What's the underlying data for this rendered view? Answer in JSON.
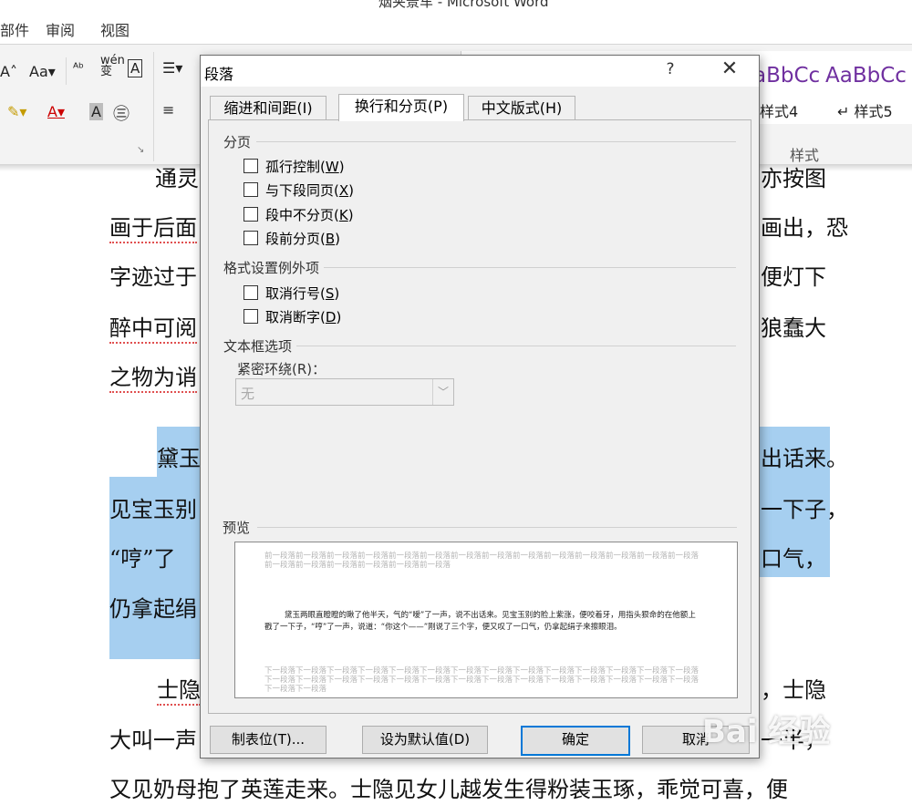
{
  "window": {
    "title": "烟夹景车 - Microsoft Word"
  },
  "menu": [
    "部件",
    "审阅",
    "视图"
  ],
  "ribbon": {
    "font_aa": "Aa",
    "wen": "wén",
    "style_samples": [
      {
        "sample": "aBbCc",
        "name": "样式4"
      },
      {
        "sample": "AaBbCc",
        "name": "样式5"
      }
    ],
    "styles_group": "样式"
  },
  "document": {
    "left_lines": [
      "通灵",
      "画于后面",
      "字迹过于",
      "醉中可阅",
      "之物为诮",
      "黛玉",
      "见宝玉别",
      "“哼”了",
      "仍拿起绢",
      "士隐",
      "大叫一声"
    ],
    "right_lines": [
      "亦按图",
      "画出，恐",
      "便灯下",
      "狼蠢大",
      "出话来。",
      "一下子，",
      "口气，",
      "，士隐",
      "一半，"
    ],
    "bottom_line": "又见奶母抱了英莲走来。士隐见女儿越发生得粉装玉琢，乖觉可喜，便"
  },
  "dialog": {
    "title": "段落",
    "help": "?",
    "close": "✕",
    "tabs": [
      "缩进和间距(I)",
      "换行和分页(P)",
      "中文版式(H)"
    ],
    "sections": {
      "pagination": "分页",
      "exceptions": "格式设置例外项",
      "textbox": "文本框选项",
      "preview": "预览"
    },
    "pagination_options": [
      {
        "label": "孤行控制",
        "key": "W"
      },
      {
        "label": "与下段同页",
        "key": "X"
      },
      {
        "label": "段中不分页",
        "key": "K"
      },
      {
        "label": "段前分页",
        "key": "B"
      }
    ],
    "exception_options": [
      {
        "label": "取消行号",
        "key": "S"
      },
      {
        "label": "取消断字",
        "key": "D"
      }
    ],
    "tight_wrap_label": "紧密环绕(R)：",
    "tight_wrap_value": "无",
    "preview": {
      "before": "前一段落前一段落前一段落前一段落前一段落前一段落前一段落前一段落前一段落前一段落前一段落前一段落前一段落前一段落前一段落前一段落前一段落前一段落前一段落前一段落",
      "main": "黛玉两眼直瞪瞪的瞅了他半天，气的“嗳”了一声，说不出话来。见宝玉别的脸上紫涨，便咬着牙，用指头狠命的在他额上戳了一下子，“哼”了一声，说道：“你这个——”刚说了三个字，便又叹了一口气，仍拿起绢子来擦眼泪。",
      "after": "下一段落下一段落下一段落下一段落下一段落下一段落下一段落下一段落下一段落下一段落下一段落下一段落下一段落下一段落下一段落下一段落下一段落下一段落下一段落下一段落下一段落下一段落下一段落下一段落下一段落下一段落下一段落下一段落下一段落下一段落"
    },
    "buttons": {
      "tabs": "制表位(T)...",
      "default": "设为默认值(D)",
      "ok": "确定",
      "cancel": "取消"
    }
  },
  "watermark": "Bai 经验"
}
